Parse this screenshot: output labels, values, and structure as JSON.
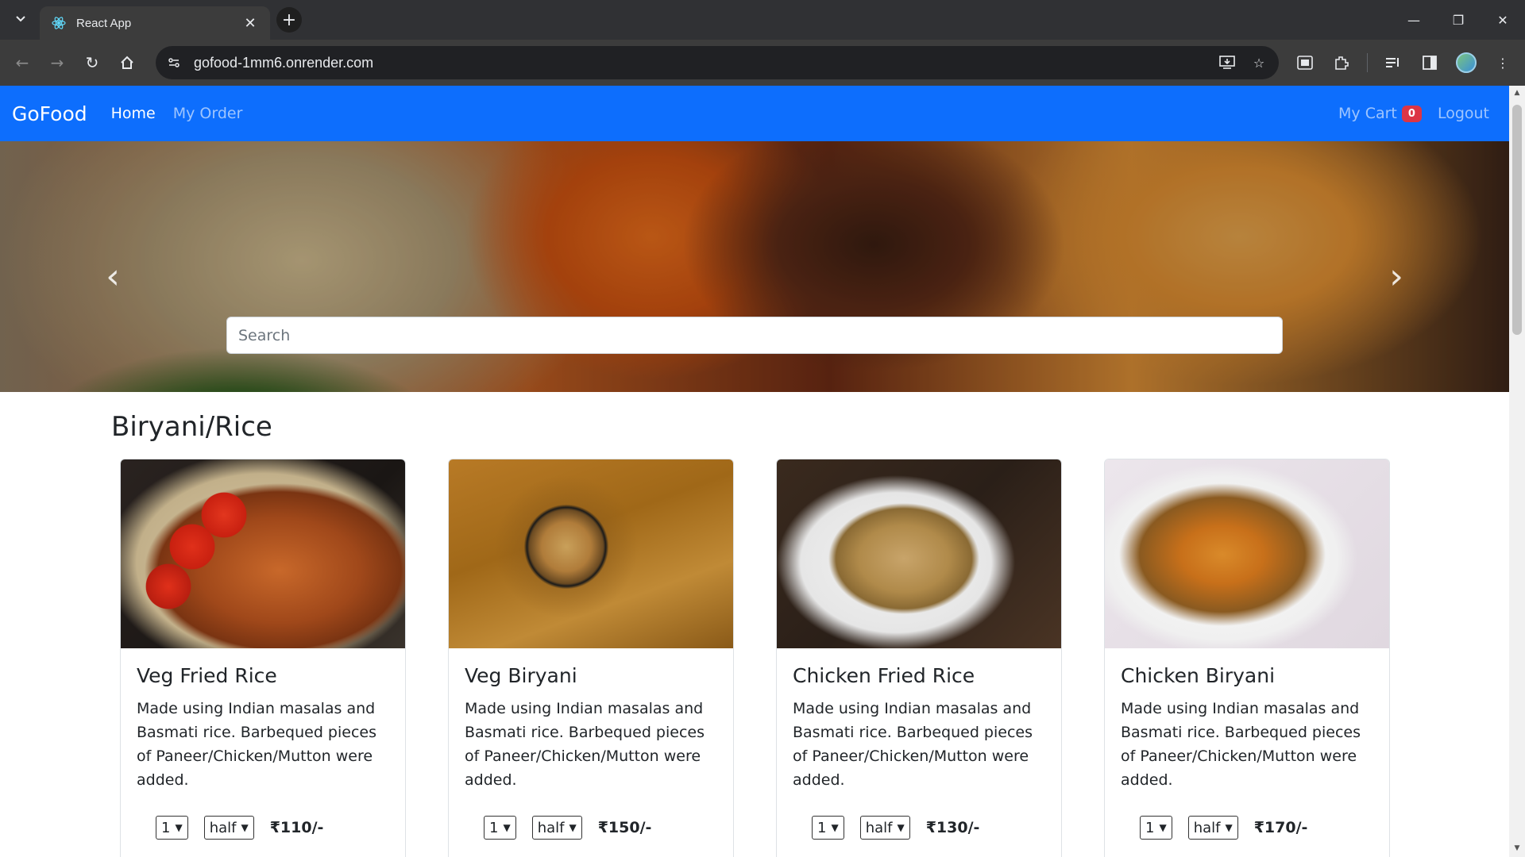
{
  "browser": {
    "tab_title": "React App",
    "url": "gofood-1mm6.onrender.com"
  },
  "nav": {
    "brand": "GoFood",
    "home": "Home",
    "my_order": "My Order",
    "my_cart": "My Cart",
    "cart_count": "0",
    "logout": "Logout"
  },
  "hero": {
    "search_placeholder": "Search"
  },
  "section": {
    "title": "Biryani/Rice"
  },
  "cards": [
    {
      "title": "Veg Fried Rice",
      "description": "Made using Indian masalas and Basmati rice. Barbequed pieces of Paneer/Chicken/Mutton were added.",
      "qty": "1",
      "size": "half",
      "price": "₹110/-"
    },
    {
      "title": "Veg Biryani",
      "description": "Made using Indian masalas and Basmati rice. Barbequed pieces of Paneer/Chicken/Mutton were added.",
      "qty": "1",
      "size": "half",
      "price": "₹150/-"
    },
    {
      "title": "Chicken Fried Rice",
      "description": "Made using Indian masalas and Basmati rice. Barbequed pieces of Paneer/Chicken/Mutton were added.",
      "qty": "1",
      "size": "half",
      "price": "₹130/-"
    },
    {
      "title": "Chicken Biryani",
      "description": "Made using Indian masalas and Basmati rice. Barbequed pieces of Paneer/Chicken/Mutton were added.",
      "qty": "1",
      "size": "half",
      "price": "₹170/-"
    }
  ],
  "colors": {
    "navbar": "#0d6efd",
    "badge": "#dc3545",
    "browser_bg": "#303134"
  }
}
